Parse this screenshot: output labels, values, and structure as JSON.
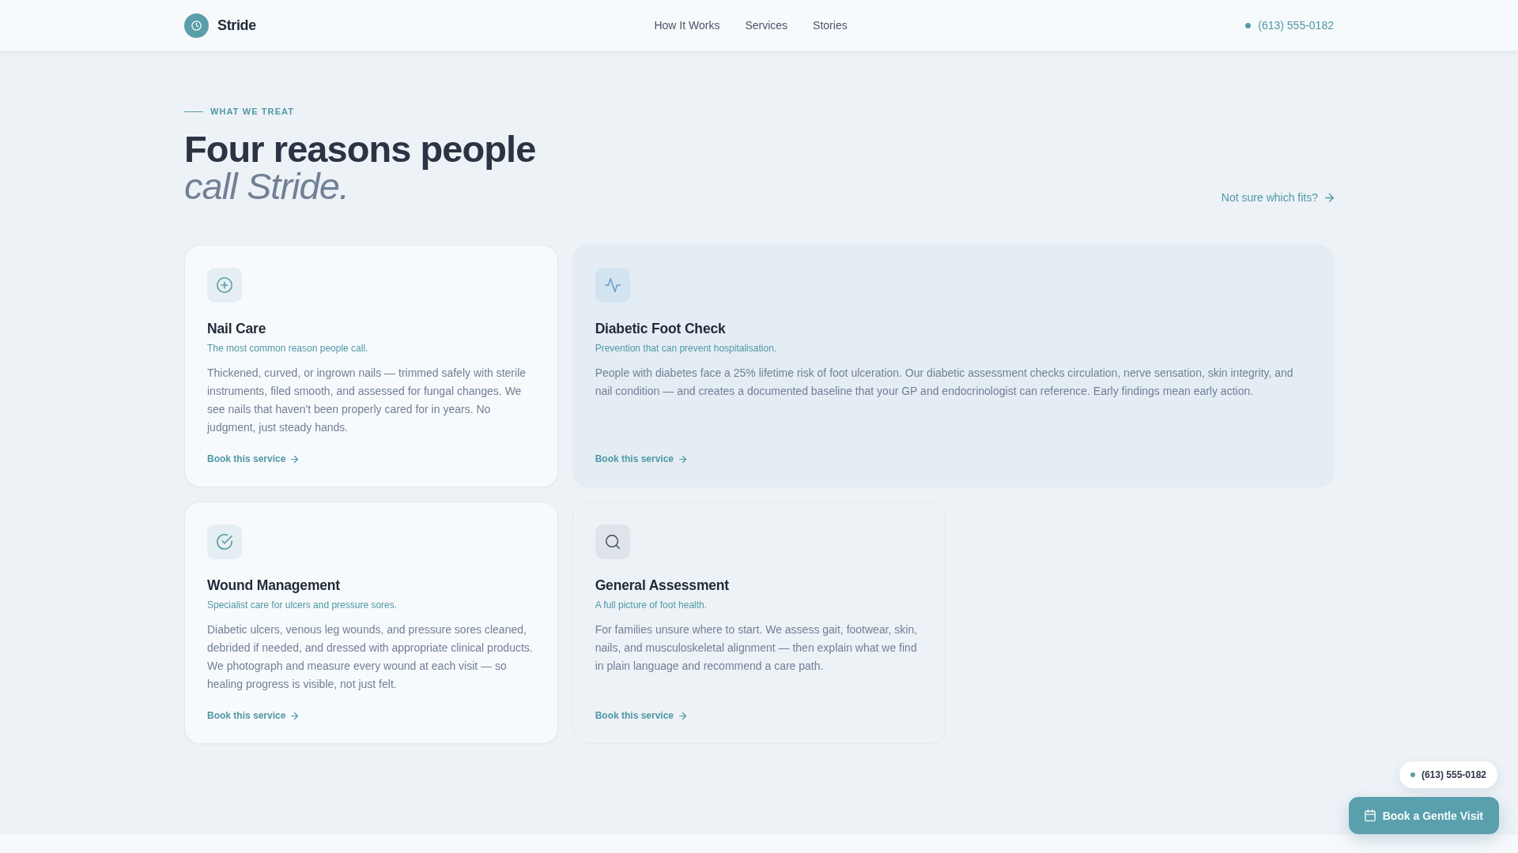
{
  "header": {
    "logo": "Stride",
    "nav": [
      "How It Works",
      "Services",
      "Stories"
    ],
    "phone": "(613) 555-0182"
  },
  "section": {
    "eyebrow": "WHAT WE TREAT",
    "heading": "Four reasons people *call Stride.*",
    "help_link": "Not sure which fits?",
    "cards": [
      {
        "kind": "plain",
        "title": "Nail Care",
        "tagline": "The most common reason people call.",
        "body": "Thickened, curved, or ingrown nails — trimmed safely with sterile instruments, filed smooth, and assessed for fungal changes. We see nails that haven't been properly cared for in years. No judgment, just steady hands.",
        "link": "Book this service"
      },
      {
        "kind": "featured",
        "title": "Diabetic Foot Check",
        "tagline": "Prevention that can prevent hospitalisation.",
        "body": "People with diabetes face a 25% lifetime risk of foot ulceration. Our diabetic assessment checks circulation, nerve sensation, skin integrity, and nail condition — and creates a documented baseline that your GP and endocrinologist can reference. Early findings mean early action.",
        "link": "Book this service"
      },
      {
        "kind": "plain",
        "title": "Wound Management",
        "tagline": "Specialist care for ulcers and pressure sores.",
        "body": "Diabetic ulcers, venous leg wounds, and pressure sores cleaned, debrided if needed, and dressed with appropriate clinical products. We photograph and measure every wound at each visit — so healing progress is visible, not just felt.",
        "link": "Book this service"
      },
      {
        "kind": "muted",
        "title": "General Assessment",
        "tagline": "A full picture of foot health.",
        "body": "For families unsure where to start. We assess gait, footwear, skin, nails, and musculoskeletal alignment — then explain what we find in plain language and recommend a care path.",
        "link": "Book this service"
      }
    ]
  },
  "floating": {
    "phone": "(613) 555-0182",
    "button": "Book a Gentle Visit"
  }
}
